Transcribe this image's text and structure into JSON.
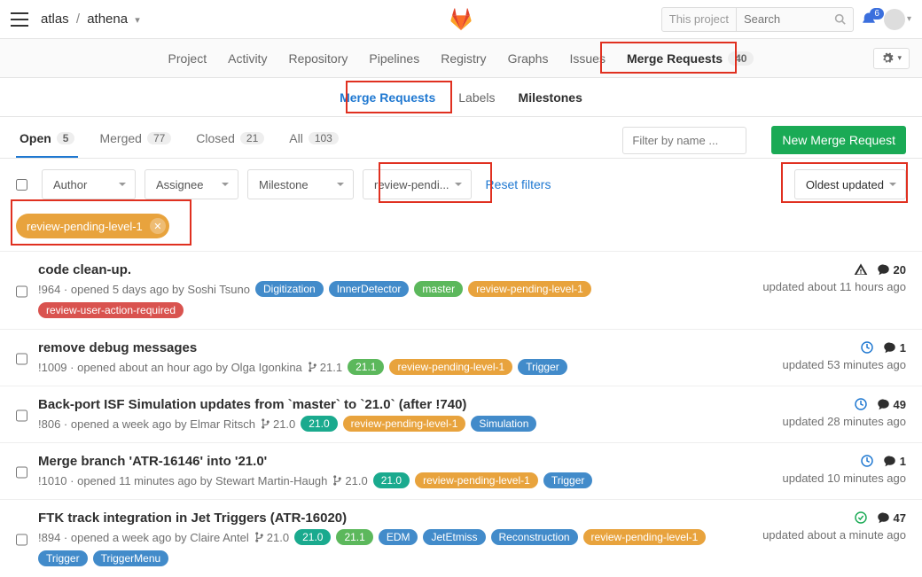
{
  "breadcrumb": {
    "group": "atlas",
    "project": "athena"
  },
  "search": {
    "scope": "This project",
    "placeholder": "Search"
  },
  "notifications": {
    "count": 6
  },
  "project_nav": {
    "items": [
      {
        "label": "Project"
      },
      {
        "label": "Activity"
      },
      {
        "label": "Repository"
      },
      {
        "label": "Pipelines"
      },
      {
        "label": "Registry"
      },
      {
        "label": "Graphs"
      },
      {
        "label": "Issues"
      },
      {
        "label": "Merge Requests",
        "active": true,
        "count": 40
      }
    ]
  },
  "sub_nav": {
    "items": [
      {
        "label": "Merge Requests",
        "active": true
      },
      {
        "label": "Labels"
      },
      {
        "label": "Milestones"
      }
    ]
  },
  "status_tabs": [
    {
      "label": "Open",
      "count": 5,
      "active": true
    },
    {
      "label": "Merged",
      "count": 77
    },
    {
      "label": "Closed",
      "count": 21
    },
    {
      "label": "All",
      "count": 103
    }
  ],
  "filter_name_placeholder": "Filter by name ...",
  "new_button": "New Merge Request",
  "filters": {
    "author": "Author",
    "assignee": "Assignee",
    "milestone": "Milestone",
    "label": "review-pendi...",
    "reset": "Reset filters",
    "sort": "Oldest updated"
  },
  "active_filter_tag": "review-pending-level-1",
  "label_colors": {
    "Digitization": "#428bca",
    "InnerDetector": "#428bca",
    "master": "#5cb85c",
    "21.1": "#5cb85c",
    "21.0": "#1aaa8e",
    "review-pending-level-1": "#e8a33d",
    "review-user-action-required": "#d9534f",
    "Trigger": "#428bca",
    "Simulation": "#428bca",
    "EDM": "#428bca",
    "JetEtmiss": "#428bca",
    "Reconstruction": "#428bca",
    "TriggerMenu": "#428bca"
  },
  "mrs": [
    {
      "title": "code clean-up.",
      "ref": "!964",
      "opened": "opened 5 days ago by",
      "author": "Soshi Tsuno",
      "branch": null,
      "labels": [
        "Digitization",
        "InnerDetector",
        "master",
        "review-pending-level-1",
        "review-user-action-required"
      ],
      "status_icon": "warning",
      "comments": 20,
      "updated": "updated about 11 hours ago"
    },
    {
      "title": "remove debug messages",
      "ref": "!1009",
      "opened": "opened about an hour ago by",
      "author": "Olga Igonkina",
      "branch": "21.1",
      "labels": [
        "21.1",
        "review-pending-level-1",
        "Trigger"
      ],
      "status_icon": "running",
      "comments": 1,
      "updated": "updated 53 minutes ago"
    },
    {
      "title": "Back-port ISF Simulation updates from `master` to `21.0` (after !740)",
      "ref": "!806",
      "opened": "opened a week ago by",
      "author": "Elmar Ritsch",
      "branch": "21.0",
      "labels": [
        "21.0",
        "review-pending-level-1",
        "Simulation"
      ],
      "status_icon": "running",
      "comments": 49,
      "updated": "updated 28 minutes ago"
    },
    {
      "title": "Merge branch 'ATR-16146' into '21.0'",
      "ref": "!1010",
      "opened": "opened 11 minutes ago by",
      "author": "Stewart Martin-Haugh",
      "branch": "21.0",
      "labels": [
        "21.0",
        "review-pending-level-1",
        "Trigger"
      ],
      "status_icon": "running",
      "comments": 1,
      "updated": "updated 10 minutes ago"
    },
    {
      "title": "FTK track integration in Jet Triggers (ATR-16020)",
      "ref": "!894",
      "opened": "opened a week ago by",
      "author": "Claire Antel",
      "branch": "21.0",
      "labels": [
        "21.0",
        "21.1",
        "EDM",
        "JetEtmiss",
        "Reconstruction",
        "review-pending-level-1",
        "Trigger",
        "TriggerMenu"
      ],
      "status_icon": "success",
      "comments": 47,
      "updated": "updated about a minute ago"
    }
  ]
}
